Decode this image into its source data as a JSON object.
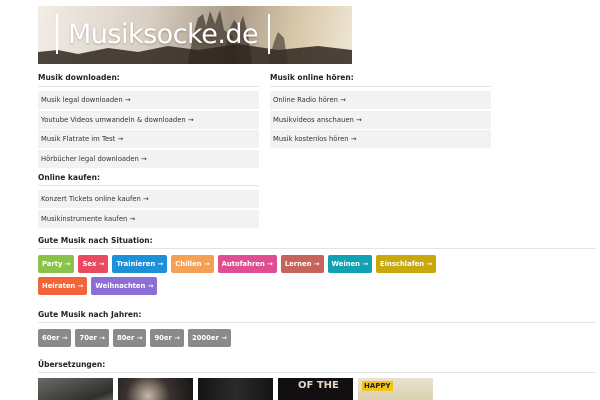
{
  "header": {
    "logo_text": "Musiksocke.de"
  },
  "download": {
    "title": "Musik downloaden:",
    "items": [
      "Musik legal downloaden →",
      "Youtube Videos umwandeln & downloaden →",
      "Musik Flatrate im Test →",
      "Hörbücher legal downloaden →"
    ]
  },
  "online": {
    "title": "Musik online hören:",
    "items": [
      "Online Radio hören →",
      "Musikvideos anschauen →",
      "Musik kostenlos hören →"
    ]
  },
  "buy": {
    "title": "Online kaufen:",
    "items": [
      "Konzert Tickets online kaufen →",
      "Musikinstrumente kaufen →"
    ]
  },
  "situation": {
    "title": "Gute Musik nach Situation:",
    "tags": [
      {
        "label": "Party →",
        "color": "#8bc34a"
      },
      {
        "label": "Sex →",
        "color": "#e84a5f"
      },
      {
        "label": "Trainieren →",
        "color": "#1e90d8"
      },
      {
        "label": "Chillen →",
        "color": "#f4a156"
      },
      {
        "label": "Autofahren →",
        "color": "#e04e92"
      },
      {
        "label": "Lernen →",
        "color": "#c76459"
      },
      {
        "label": "Weinen →",
        "color": "#12a1b3"
      },
      {
        "label": "Einschlafen →",
        "color": "#c9a80e"
      },
      {
        "label": "Heiraten →",
        "color": "#f2653a"
      },
      {
        "label": "Weihnachten →",
        "color": "#8c6fd4"
      }
    ]
  },
  "years": {
    "title": "Gute Musik nach Jahren:",
    "tags": [
      {
        "label": "60er →",
        "color": "#8a8a8a"
      },
      {
        "label": "70er →",
        "color": "#8a8a8a"
      },
      {
        "label": "80er →",
        "color": "#8a8a8a"
      },
      {
        "label": "90er →",
        "color": "#8a8a8a"
      },
      {
        "label": "2000er →",
        "color": "#8a8a8a"
      }
    ]
  },
  "translations": {
    "title": "Übersetzungen:",
    "thumbs": [
      {
        "text": ""
      },
      {
        "text": ""
      },
      {
        "text": ""
      },
      {
        "text": "OF THE"
      },
      {
        "text": "HAPPY"
      }
    ]
  }
}
